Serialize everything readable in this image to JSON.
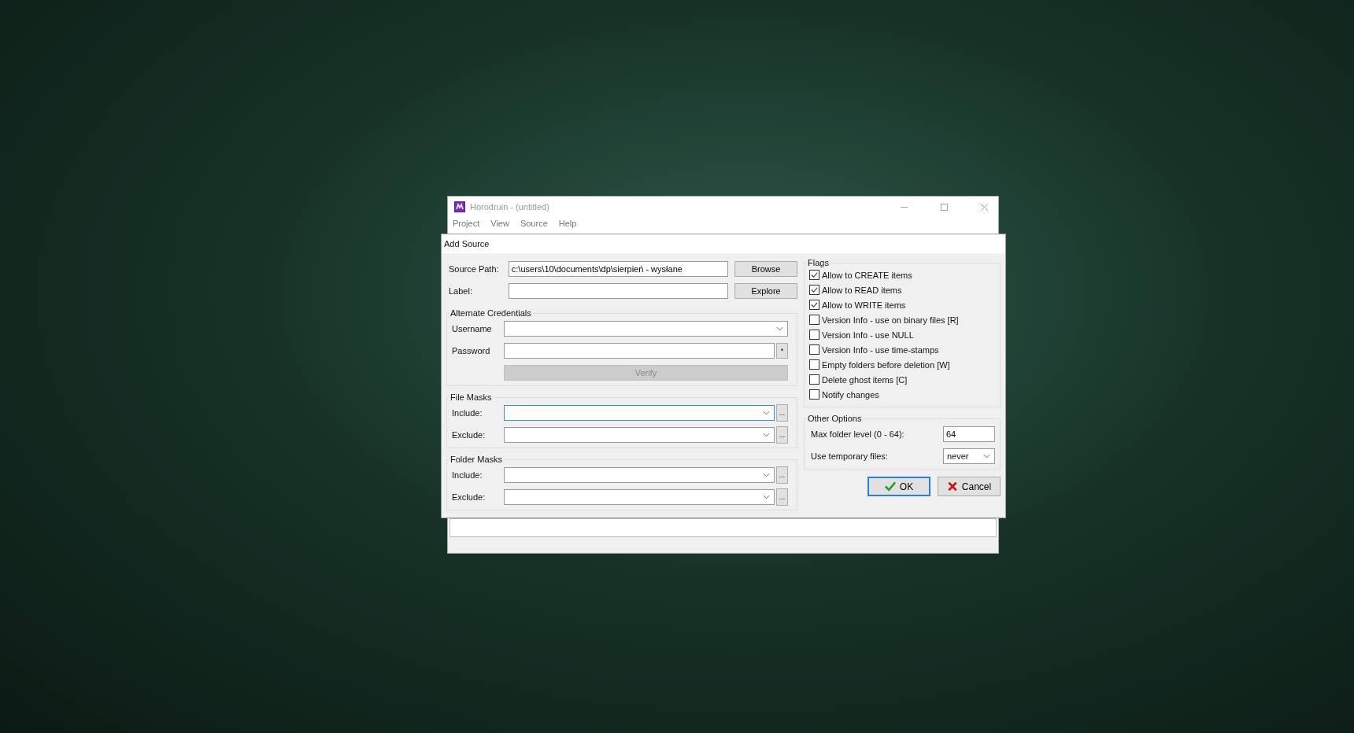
{
  "window": {
    "title": "Horodruin - (untitled)",
    "menu": [
      "Project",
      "View",
      "Source",
      "Help"
    ]
  },
  "dialog": {
    "title": "Add Source",
    "source_path": {
      "label": "Source Path:",
      "value": "c:\\users\\10\\documents\\dp\\sierpień - wysłane",
      "button": "Browse"
    },
    "label_field": {
      "label": "Label:",
      "button": "Explore"
    },
    "credentials": {
      "title": "Alternate Credentials",
      "username_label": "Username",
      "password_label": "Password",
      "reveal": "*",
      "verify": {
        "label": "Verify",
        "disabled": true
      }
    },
    "mask_groups": [
      {
        "title": "File Masks",
        "rows": [
          {
            "label": "Include:",
            "focused": true,
            "more": "..."
          },
          {
            "label": "Exclude:",
            "focused": false,
            "more": "..."
          }
        ]
      },
      {
        "title": "Folder Masks",
        "rows": [
          {
            "label": "Include:",
            "focused": false,
            "more": "..."
          },
          {
            "label": "Exclude:",
            "focused": false,
            "more": "..."
          }
        ]
      }
    ],
    "flags": {
      "title": "Flags",
      "items": [
        {
          "label": "Allow to CREATE items",
          "checked": true
        },
        {
          "label": "Allow to READ items",
          "checked": true
        },
        {
          "label": "Allow to WRITE items",
          "checked": true
        },
        {
          "label": "Version Info - use on binary files [R]",
          "checked": false
        },
        {
          "label": "Version Info - use NULL",
          "checked": false
        },
        {
          "label": "Version Info - use time-stamps",
          "checked": false
        },
        {
          "label": "Empty folders before deletion [W]",
          "checked": false
        },
        {
          "label": "Delete ghost items [C]",
          "checked": false
        },
        {
          "label": "Notify changes",
          "checked": false
        }
      ]
    },
    "other_options": {
      "title": "Other Options",
      "max_level": {
        "label": "Max folder level (0 - 64):",
        "value": "64"
      },
      "temp_files": {
        "label": "Use temporary files:",
        "value": "never"
      }
    },
    "buttons": [
      {
        "label": "OK",
        "kind": "ok",
        "default": true
      },
      {
        "label": "Cancel",
        "kind": "cancel",
        "default": false
      }
    ]
  }
}
